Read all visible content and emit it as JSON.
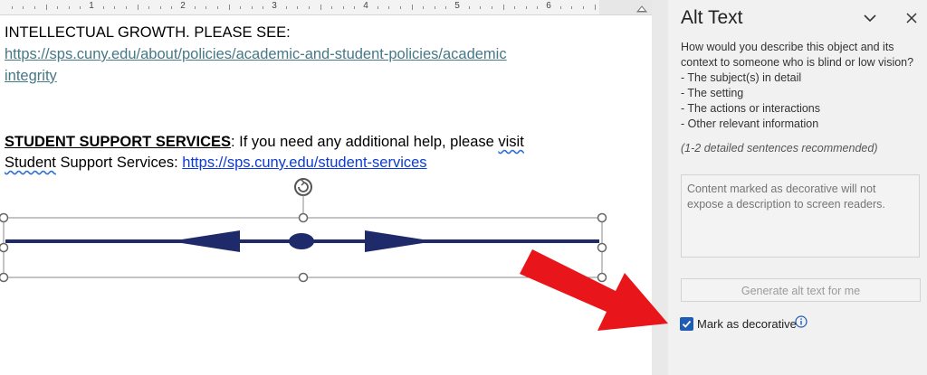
{
  "ruler": {
    "numbers": [
      "1",
      "2",
      "3",
      "4",
      "5",
      "6"
    ]
  },
  "document": {
    "line1": "INTELLECTUAL GROWTH. PLEASE SEE:",
    "link1_part1": "https://sps.cuny.edu/about/policies/academic-and-student-policies/academic",
    "link1_part2": "integrity",
    "support_heading": "STUDENT SUPPORT SERVICES",
    "support_text1": ": If you need any additional help, please ",
    "support_visit": "visit ",
    "support_student": "Student",
    "support_text2": " Support Services: ",
    "support_link": "https://sps.cuny.edu/student-services"
  },
  "pane": {
    "title": "Alt Text",
    "question_line1": "How would you describe this object and its",
    "question_line2": "context to someone who is blind or low vision?",
    "bullets": [
      "- The subject(s) in detail",
      "- The setting",
      "- The actions or interactions",
      "- Other relevant information"
    ],
    "recommend": "(1-2 detailed sentences recommended)",
    "textarea_placeholder": "Content marked as decorative will not expose a description to screen readers.",
    "generate_label": "Generate alt text for me",
    "decorative_label": "Mark as decorative",
    "decorative_checked": true
  },
  "colors": {
    "accent": "#1e5cb3",
    "shape_navy": "#1f2a6b",
    "callout_red": "#e8151b",
    "link_teal": "#467886",
    "link_blue": "#0b3bd6"
  },
  "icons": [
    "collapse-chevron-icon",
    "close-icon",
    "rotate-handle-icon",
    "info-icon",
    "check-icon",
    "indent-marker-icon"
  ]
}
